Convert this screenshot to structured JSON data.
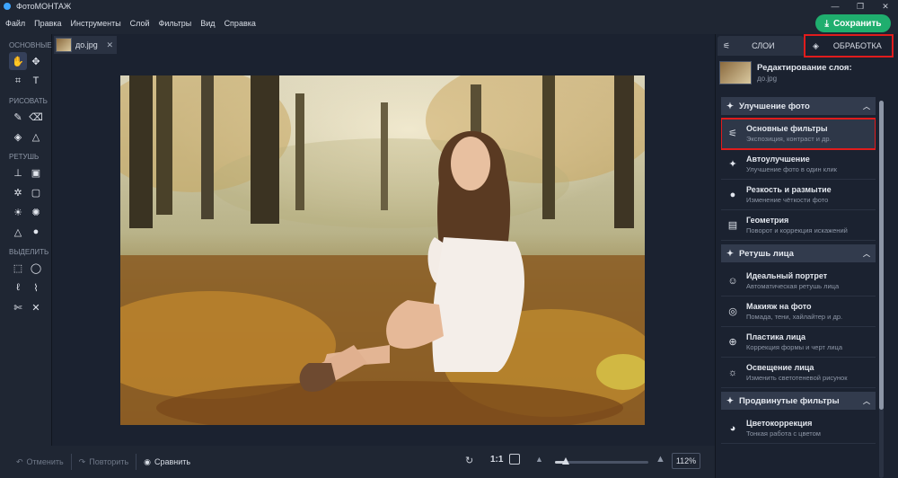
{
  "app": {
    "title": "ФотоМОНТАЖ",
    "window_controls": [
      "—",
      "❐",
      "✕"
    ]
  },
  "menu": {
    "items": [
      "Файл",
      "Правка",
      "Инструменты",
      "Слой",
      "Фильтры",
      "Вид",
      "Справка"
    ],
    "save_label": "Сохранить"
  },
  "tools": {
    "sections": [
      {
        "label": "ОСНОВНЫЕ",
        "icons": [
          "hand-icon",
          "move-icon",
          "crop-icon",
          "text-icon"
        ],
        "glyphs": [
          "✋",
          "✥",
          "⌗",
          "T"
        ]
      },
      {
        "label": "РИСОВАТЬ",
        "icons": [
          "brush-icon",
          "eraser-icon",
          "fill-icon",
          "shapes-icon"
        ],
        "glyphs": [
          "✎",
          "⌫",
          "◈",
          "△"
        ]
      },
      {
        "label": "РЕТУШЬ",
        "icons": [
          "stamp-icon",
          "patch-icon",
          "heal-icon",
          "frame-icon",
          "light-icon",
          "dodge-icon",
          "triangle-icon",
          "drop-icon"
        ],
        "glyphs": [
          "⊥",
          "▣",
          "✲",
          "▢",
          "☀",
          "✺",
          "△",
          "●"
        ]
      },
      {
        "label": "ВЫДЕЛИТЬ",
        "icons": [
          "rect-select-icon",
          "ellipse-select-icon",
          "lasso-icon",
          "poly-lasso-icon",
          "magic-select-icon",
          "magic-wand-icon"
        ],
        "glyphs": [
          "⬚",
          "◯",
          "ℓ",
          "⌇",
          "✄",
          "✕"
        ]
      }
    ]
  },
  "document": {
    "tab_name": "до.jpg",
    "close": "✕"
  },
  "bottombar": {
    "undo": "Отменить",
    "redo": "Повторить",
    "compare": "Сравнить",
    "ratio": "1:1",
    "zoom": "112%",
    "zoom_level": 0.12
  },
  "rightpanel": {
    "tabs": {
      "layers": "СЛОИ",
      "processing": "ОБРАБОТКА"
    },
    "layer_title": "Редактирование слоя:",
    "layer_file": "до.jpg",
    "groups": [
      {
        "title": "Улучшение фото",
        "icon": "wand-icon",
        "items": [
          {
            "title": "Основные фильтры",
            "sub": "Экспозиция, контраст и др.",
            "icon": "sliders-icon",
            "glyph": "⚟",
            "selected": true
          },
          {
            "title": "Автоулучшение",
            "sub": "Улучшение фото в один клик",
            "icon": "magic-wand-icon",
            "glyph": "✦"
          },
          {
            "title": "Резкость и размытие",
            "sub": "Изменение чёткости фото",
            "icon": "drop-icon",
            "glyph": "●"
          },
          {
            "title": "Геометрия",
            "sub": "Поворот и коррекция искажений",
            "icon": "image-frame-icon",
            "glyph": "▤"
          }
        ]
      },
      {
        "title": "Ретушь лица",
        "icon": "face-retouch-icon",
        "items": [
          {
            "title": "Идеальный портрет",
            "sub": "Автоматическая ретушь лица",
            "icon": "portrait-icon",
            "glyph": "☺"
          },
          {
            "title": "Макияж на фото",
            "sub": "Помада, тени, хайлайтер и др.",
            "icon": "makeup-icon",
            "glyph": "◎"
          },
          {
            "title": "Пластика лица",
            "sub": "Коррекция формы и черт лица",
            "icon": "face-shape-icon",
            "glyph": "⊕"
          },
          {
            "title": "Освещение лица",
            "sub": "Изменить светотеневой рисунок",
            "icon": "face-light-icon",
            "glyph": "☼"
          }
        ]
      },
      {
        "title": "Продвинутые фильтры",
        "icon": "advanced-filters-icon",
        "items": [
          {
            "title": "Цветокоррекция",
            "sub": "Тонкая работа с цветом",
            "icon": "palette-icon",
            "glyph": "◕"
          }
        ]
      }
    ]
  }
}
